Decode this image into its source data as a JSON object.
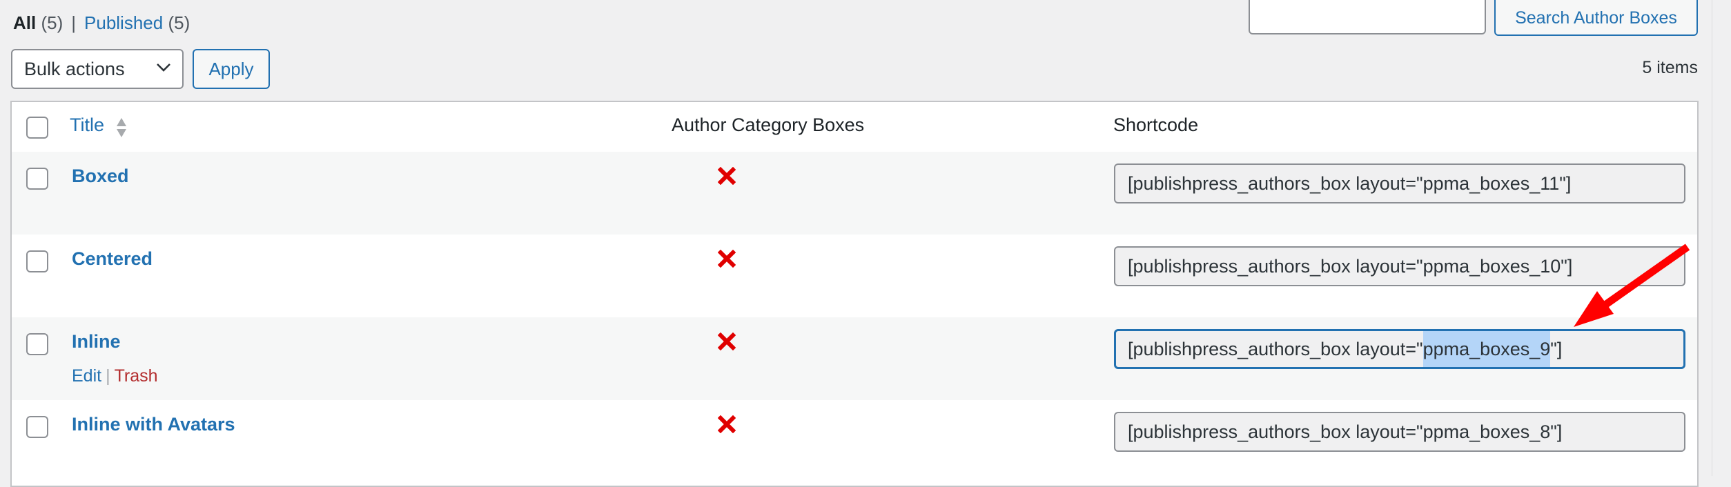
{
  "filters": {
    "all_label": "All",
    "all_count": "(5)",
    "separator": "|",
    "published_label": "Published",
    "published_count": "(5)"
  },
  "search": {
    "value": "",
    "button_label": "Search Author Boxes"
  },
  "bulk": {
    "selected": "Bulk actions",
    "apply_label": "Apply"
  },
  "items_count": "5 items",
  "table": {
    "columns": {
      "title": "Title",
      "category": "Author Category Boxes",
      "shortcode": "Shortcode"
    },
    "rows": [
      {
        "title": "Boxed",
        "category_icon": "red-x-icon",
        "shortcode": "[publishpress_authors_box layout=\"ppma_boxes_11\"]"
      },
      {
        "title": "Centered",
        "category_icon": "red-x-icon",
        "shortcode": "[publishpress_authors_box layout=\"ppma_boxes_10\"]"
      },
      {
        "title": "Inline",
        "category_icon": "red-x-icon",
        "shortcode_prefix": "[publishpress_authors_box layout=\"",
        "shortcode_selected": "ppma_boxes_9",
        "shortcode_suffix": "\"]",
        "actions": {
          "edit": "Edit",
          "separator": "|",
          "trash": "Trash"
        }
      },
      {
        "title": "Inline with Avatars",
        "category_icon": "red-x-icon",
        "shortcode": "[publishpress_authors_box layout=\"ppma_boxes_8\"]"
      }
    ]
  },
  "colors": {
    "link": "#2271b1",
    "trash": "#b32d2e",
    "x_icon": "#e00000",
    "annotation_arrow": "#ff0000",
    "selection": "#b4d5f8"
  }
}
